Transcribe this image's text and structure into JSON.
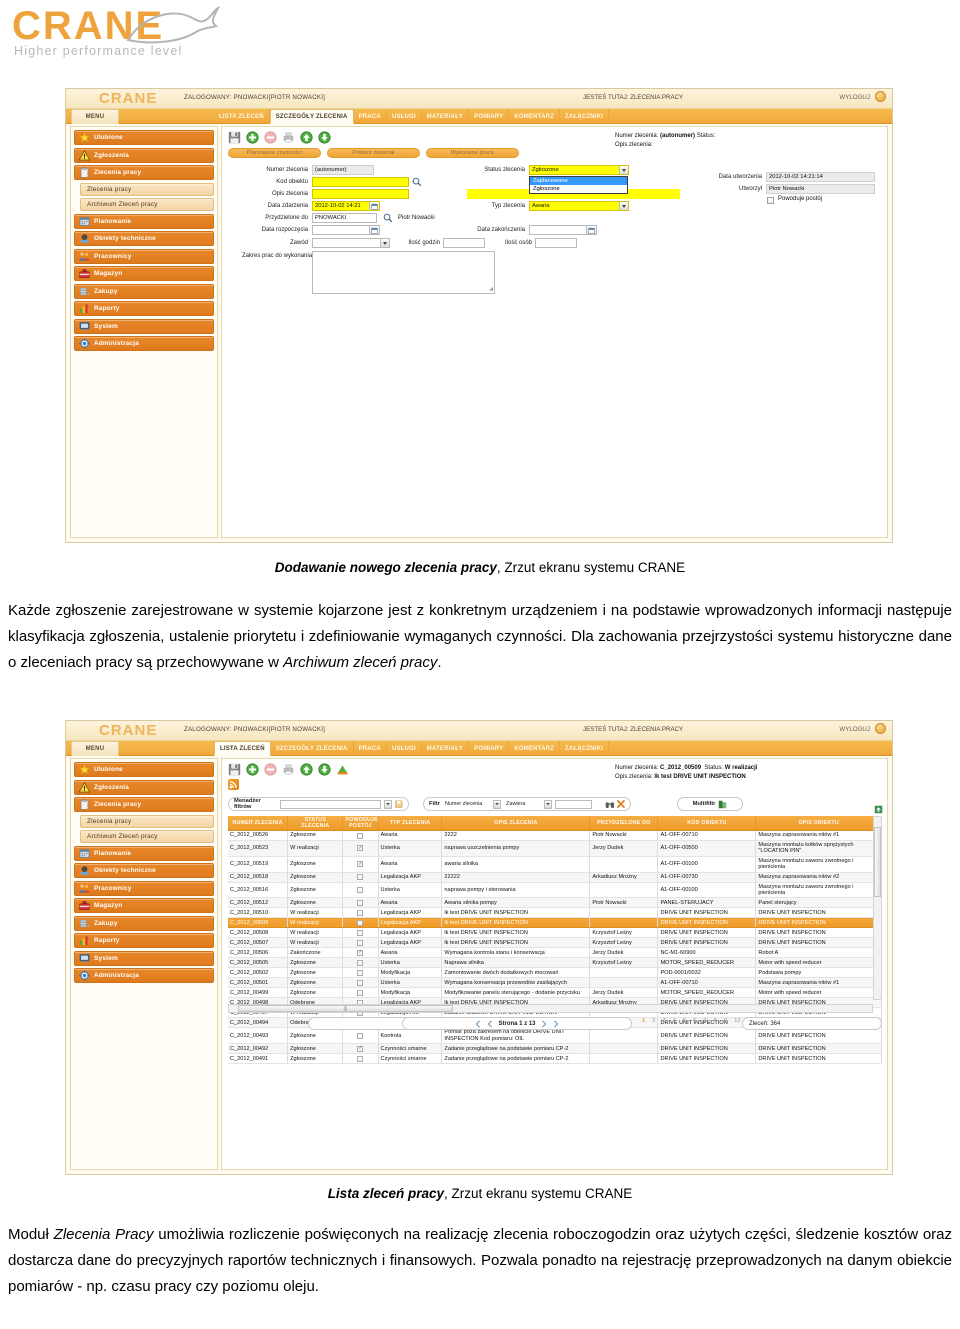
{
  "brand": {
    "name": "CRANE",
    "tagline": "Higher performance level",
    "accent": "#efa33c"
  },
  "screenshot1": {
    "app": {
      "logo": "CRANE",
      "logged_in": "ZALOGOWANY: PNOWACKI[PIOTR NOWACKI]",
      "you_are_here": "JESTEŚ TUTAJ: ZLECENIA PRACY",
      "logout": "WYLOGUJ"
    },
    "menu_tab": "MENU",
    "tabs": [
      {
        "label": "LISTA ZLECEŃ",
        "active": false
      },
      {
        "label": "SZCZEGÓŁY ZLECENIA",
        "active": true
      },
      {
        "label": "PRACA",
        "active": false
      },
      {
        "label": "USŁUGI",
        "active": false
      },
      {
        "label": "MATERIAŁY",
        "active": false
      },
      {
        "label": "POMIARY",
        "active": false
      },
      {
        "label": "KOMENTARZ",
        "active": false
      },
      {
        "label": "ZAŁĄCZNIKI",
        "active": false
      }
    ],
    "sidebar": [
      {
        "label": "Ulubione",
        "icon": "star-icon",
        "sub": false
      },
      {
        "label": "Zgłoszenia",
        "icon": "warning-icon",
        "sub": false
      },
      {
        "label": "Zlecenia pracy",
        "icon": "clipboard-icon",
        "sub": false
      },
      {
        "label": "Zlecenia pracy",
        "icon": "",
        "sub": true
      },
      {
        "label": "Archiwum Zleceń pracy",
        "icon": "",
        "sub": true
      },
      {
        "label": "Planowanie",
        "icon": "calendar-icon",
        "sub": false
      },
      {
        "label": "Obiekty techniczne",
        "icon": "object-icon",
        "sub": false
      },
      {
        "label": "Pracownicy",
        "icon": "people-icon",
        "sub": false
      },
      {
        "label": "Magazyn",
        "icon": "toolbox-icon",
        "sub": false
      },
      {
        "label": "Zakupy",
        "icon": "cart-icon",
        "sub": false
      },
      {
        "label": "Raporty",
        "icon": "chart-icon",
        "sub": false
      },
      {
        "label": "System",
        "icon": "monitor-icon",
        "sub": false
      },
      {
        "label": "Administracja",
        "icon": "gear-icon",
        "sub": false
      }
    ],
    "toolbar_icons": [
      "save-icon",
      "add-icon",
      "delete-icon",
      "print-icon",
      "up-icon",
      "down-icon"
    ],
    "action_buttons": [
      "Planowane czynności",
      "Pobierz materiał",
      "Wykonane prace"
    ],
    "form": {
      "numer_zlecenia_label": "Numer zlecenia",
      "numer_zlecenia_value": "(autonumer)",
      "kod_obiektu_label": "Kod obiektu",
      "kod_obiektu_value": "",
      "opis_zlecenia_label": "Opis zlecenia",
      "opis_zlecenia_value": "",
      "data_zdarzenia_label": "Data zdarzenia",
      "data_zdarzenia_value": "2012-10-02 14:21",
      "przydzielone_do_label": "Przydzielone do",
      "przydzielone_do_value": "PNOWACKI",
      "przydzielone_do_name": "Piotr Nowacki",
      "data_rozpoczecia_label": "Data rozpoczęcia",
      "data_rozpoczecia_value": "",
      "zawod_label": "Zawód",
      "zawod_value": "",
      "zakres_prac_label": "Zakres prac do wykonania",
      "zakres_prac_value": "",
      "status_zlecenia_label": "Status zlecenia",
      "status_zlecenia_value": "Zgłoszone",
      "status_options": [
        "Zaplanowane",
        "Zgłoszone"
      ],
      "status_selected_option": "Zaplanowane",
      "typ_zlecenia_label": "Typ zlecenia",
      "typ_zlecenia_value": "Awaria",
      "data_zakonczenia_label": "Data zakończenia",
      "data_zakonczenia_value": "",
      "ilosc_godzin_label": "Ilość godzin",
      "ilosc_godzin_value": "",
      "ilosc_osob_label": "Ilość osób",
      "ilosc_osob_value": ""
    },
    "header_info": {
      "numer_label": "Numer zlecenia:",
      "numer_value": "(autonumer)",
      "status_label": "Status:",
      "status_value": "",
      "opis_label": "Opis zlecenia:",
      "opis_value": ""
    },
    "meta": {
      "data_utworzenia_label": "Data utworzenia",
      "data_utworzenia_value": "2012-10-02 14:21:14",
      "utworzyl_label": "Utworzył",
      "utworzyl_value": "Piotr Nowacki",
      "powoduje_postoj_label": "Powoduje postój",
      "powoduje_postoj_checked": false
    }
  },
  "caption1": {
    "bold": "Dodawanie nowego zlecenia pracy",
    "rest": ", Zrzut ekranu systemu CRANE"
  },
  "paragraph1": "Każde zgłoszenie zarejestrowane w systemie kojarzone jest z konkretnym urządzeniem i na podstawie wprowadzonych informacji następuje klasyfikacja zgłoszenia, ustalenie priorytetu i zdefiniowanie wymaganych czynności. Dla zachowania przejrzystości systemu historyczne dane o zleceniach pracy są przechowywane w ",
  "paragraph1_italic_tail": "Archiwum zleceń pracy",
  "paragraph1_end": ".",
  "screenshot2": {
    "app": {
      "logo": "CRANE",
      "logged_in": "ZALOGOWANY: PNOWACKI[PIOTR NOWACKI]",
      "you_are_here": "JESTEŚ TUTAJ: ZLECENIA PRACY",
      "logout": "WYLOGUJ"
    },
    "menu_tab": "MENU",
    "tabs": [
      {
        "label": "LISTA ZLECEŃ",
        "active": true
      },
      {
        "label": "SZCZEGÓŁY ZLECENIA",
        "active": false
      },
      {
        "label": "PRACA",
        "active": false
      },
      {
        "label": "USŁUGI",
        "active": false
      },
      {
        "label": "MATERIAŁY",
        "active": false
      },
      {
        "label": "POMIARY",
        "active": false
      },
      {
        "label": "KOMENTARZ",
        "active": false
      },
      {
        "label": "ZAŁĄCZNIKI",
        "active": false
      }
    ],
    "sidebar": [
      {
        "label": "Ulubione",
        "icon": "star-icon",
        "sub": false
      },
      {
        "label": "Zgłoszenia",
        "icon": "warning-icon",
        "sub": false
      },
      {
        "label": "Zlecenia pracy",
        "icon": "clipboard-icon",
        "sub": false
      },
      {
        "label": "Zlecenia pracy",
        "icon": "",
        "sub": true
      },
      {
        "label": "Archiwum Zleceń pracy",
        "icon": "",
        "sub": true
      },
      {
        "label": "Planowanie",
        "icon": "calendar-icon",
        "sub": false
      },
      {
        "label": "Obiekty techniczne",
        "icon": "object-icon",
        "sub": false
      },
      {
        "label": "Pracownicy",
        "icon": "people-icon",
        "sub": false
      },
      {
        "label": "Magazyn",
        "icon": "toolbox-icon",
        "sub": false
      },
      {
        "label": "Zakupy",
        "icon": "cart-icon",
        "sub": false
      },
      {
        "label": "Raporty",
        "icon": "chart-icon",
        "sub": false
      },
      {
        "label": "System",
        "icon": "monitor-icon",
        "sub": false
      },
      {
        "label": "Administracja",
        "icon": "gear-icon",
        "sub": false
      }
    ],
    "toolbar_icons": [
      "save-icon",
      "add-icon",
      "delete-icon",
      "print-icon",
      "up-icon",
      "down-icon",
      "export-icon",
      "rss-icon"
    ],
    "header_info": {
      "numer_label": "Numer zlecenia:",
      "numer_value": "C_2012_00509",
      "status_label": "Status:",
      "status_value": "W realizacji",
      "opis_label": "Opis zlecenia:",
      "opis_value": "lk test DRIVE UNIT INSPECTION"
    },
    "filterbar": {
      "menadzer_label": "Menadżer filtrów",
      "menadzer_value": "",
      "filtr_label": "Filtr",
      "filtr_field": "Numer zlecenia",
      "filtr_operator": "Zawiera",
      "filtr_value": "",
      "search_icon": "binoculars-icon",
      "clear_icon": "clear-x-icon",
      "multifiltr_label": "Multifiltr"
    },
    "table": {
      "columns": [
        "NUMER ZLECENIA",
        "STATUS ZLECENIA",
        "POWODUJE POSTÓJ",
        "TYP ZLECENIA",
        "OPIS ZLECENIA",
        "PRZYDZIELONE DO",
        "KOD OBIEKTU",
        "OPIS OBIEKTU"
      ],
      "rows": [
        {
          "numer": "C_2012_00526",
          "status": "Zgłoszone",
          "postoj": false,
          "typ": "Awaria",
          "opis": "2222",
          "przydzielone": "Piotr Nowacki",
          "kod": "A1-OFF-00710",
          "opis_obiektu": "Maszyna zaprasowania nitów #1",
          "selected": false
        },
        {
          "numer": "C_2012_00523",
          "status": "W realizacji",
          "postoj": true,
          "typ": "Usterka",
          "opis": "naprawa uszczelnienia pompy",
          "przydzielone": "Jerzy Dudek",
          "kod": "A1-OFF-00500",
          "opis_obiektu": "Maszyna montażu kołków sprężystych \"LOCATION PIN\"",
          "selected": false
        },
        {
          "numer": "C_2012_00519",
          "status": "Zgłoszone",
          "postoj": true,
          "typ": "Awaria",
          "opis": "awaria silnika",
          "przydzielone": "",
          "kod": "A1-OFF-00100",
          "opis_obiektu": "Maszyna montażu zaworu zwrotnego i pierścienia",
          "selected": false
        },
        {
          "numer": "C_2012_00518",
          "status": "Zgłoszone",
          "postoj": false,
          "typ": "Legalizacja AKP",
          "opis": "22222",
          "przydzielone": "Arkadiusz Mroźny",
          "kod": "A1-OFF-00730",
          "opis_obiektu": "Maszyna zaprasowania nitów #2",
          "selected": false
        },
        {
          "numer": "C_2012_00516",
          "status": "Zgłoszone",
          "postoj": false,
          "typ": "Usterka",
          "opis": "naprawa pompy i sterowania",
          "przydzielone": "",
          "kod": "A1-OFF-00100",
          "opis_obiektu": "Maszyna montażu zaworu zwrotnego i pierścienia",
          "selected": false
        },
        {
          "numer": "C_2012_00512",
          "status": "Zgłoszone",
          "postoj": false,
          "typ": "Awaria",
          "opis": "Awaria silnika pompy",
          "przydzielone": "Piotr Nowacki",
          "kod": "PANEL-STERUJACY",
          "opis_obiektu": "Panel sterujący",
          "selected": false
        },
        {
          "numer": "C_2012_00510",
          "status": "W realizacji",
          "postoj": false,
          "typ": "Legalizacja AKP",
          "opis": "lk test DRIVE UNIT INSPECTION",
          "przydzielone": "",
          "kod": "DRIVE UNIT INSPECTION",
          "opis_obiektu": "DRIVE UNIT INSPECTION",
          "selected": false
        },
        {
          "numer": "C_2012_00509",
          "status": "W realizacji",
          "postoj": false,
          "typ": "Legalizacja AKP",
          "opis": "lk test DRIVE UNIT INSPECTION",
          "przydzielone": "",
          "kod": "DRIVE UNIT INSPECTION",
          "opis_obiektu": "DRIVE UNIT INSPECTION",
          "selected": true
        },
        {
          "numer": "C_2012_00508",
          "status": "W realizacji",
          "postoj": false,
          "typ": "Legalizacja AKP",
          "opis": "lk test DRIVE UNIT INSPECTION",
          "przydzielone": "Krzysztof Leśny",
          "kod": "DRIVE UNIT INSPECTION",
          "opis_obiektu": "DRIVE UNIT INSPECTION",
          "selected": false
        },
        {
          "numer": "C_2012_00507",
          "status": "W realizacji",
          "postoj": false,
          "typ": "Legalizacja AKP",
          "opis": "lk test DRIVE UNIT INSPECTION",
          "przydzielone": "Krzysztof Leśny",
          "kod": "DRIVE UNIT INSPECTION",
          "opis_obiektu": "DRIVE UNIT INSPECTION",
          "selected": false
        },
        {
          "numer": "C_2012_00506",
          "status": "Zakończone",
          "postoj": true,
          "typ": "Awaria",
          "opis": "Wymagana kontrola stanu i konserwacja",
          "przydzielone": "Jerzy Dudek",
          "kod": "NC-M1-60900",
          "opis_obiektu": "Robot A",
          "selected": false
        },
        {
          "numer": "C_2012_00505",
          "status": "Zgłoszone",
          "postoj": false,
          "typ": "Usterka",
          "opis": "Naprawa silnika",
          "przydzielone": "Krzysztof Leśny",
          "kod": "MOTOR_SPEED_REDUCER",
          "opis_obiektu": "Motor with speed reducer",
          "selected": false
        },
        {
          "numer": "C_2012_00502",
          "status": "Zgłoszone",
          "postoj": false,
          "typ": "Modyfikacja",
          "opis": "Zamontowanie dwóch dodatkowych mocowań",
          "przydzielone": "",
          "kod": "POD-0001/0032",
          "opis_obiektu": "Podstawa pompy",
          "selected": false
        },
        {
          "numer": "C_2012_00501",
          "status": "Zgłoszone",
          "postoj": false,
          "typ": "Usterka",
          "opis": "Wymagana konserwacja przewodów zasilających",
          "przydzielone": "",
          "kod": "A1-OFF-00710",
          "opis_obiektu": "Maszyna zaprasowania nitów #1",
          "selected": false
        },
        {
          "numer": "C_2012_00499",
          "status": "Zgłoszone",
          "postoj": false,
          "typ": "Modyfikacja",
          "opis": "Modyfikowanie panelu sterującego - dodanie przycisku",
          "przydzielone": "Jerzy Dudek",
          "kod": "MOTOR_SPEED_REDUCER",
          "opis_obiektu": "Motor with speed reducer",
          "selected": false
        },
        {
          "numer": "C_2012_00498",
          "status": "Odebrane",
          "postoj": false,
          "typ": "Legalizacja AKP",
          "opis": "lk test DRIVE UNIT INSPECTION",
          "przydzielone": "Arkadiusz Mroźny",
          "kod": "DRIVE UNIT INSPECTION",
          "opis_obiektu": "DRIVE UNIT INSPECTION",
          "selected": false
        },
        {
          "numer": "C_2012_00497",
          "status": "W realizacji",
          "postoj": false,
          "typ": "Legalizacja AKP",
          "opis": "Zadanie czasowe DRIVE UNIT INSPECTION",
          "przydzielone": "",
          "kod": "DRIVE UNIT INSPECTION",
          "opis_obiektu": "DRIVE UNIT INSPECTION",
          "selected": false
        },
        {
          "numer": "C_2012_00494",
          "status": "Odebrane",
          "postoj": false,
          "typ": "Legalizacja AKP",
          "opis": "Zadanie czasowe DRIVE UNIT INSPECTION",
          "przydzielone": "Bogumił Rogal",
          "kod": "DRIVE UNIT INSPECTION",
          "opis_obiektu": "DRIVE UNIT INSPECTION",
          "selected": false
        },
        {
          "numer": "C_2012_00493",
          "status": "Zgłoszone",
          "postoj": false,
          "typ": "Kontrola",
          "opis": "Pomiar poza zakresem na obiekcie DRIVE UNIT INSPECTION Kod pomiaru: OIL",
          "przydzielone": "",
          "kod": "DRIVE UNIT INSPECTION",
          "opis_obiektu": "DRIVE UNIT INSPECTION",
          "selected": false
        },
        {
          "numer": "C_2012_00492",
          "status": "Zgłoszone",
          "postoj": true,
          "typ": "Czynności smarne",
          "opis": "Zadanie przeglądowe na podstawie pomiaru CP-2",
          "przydzielone": "",
          "kod": "DRIVE UNIT INSPECTION",
          "opis_obiektu": "DRIVE UNIT INSPECTION",
          "selected": false
        },
        {
          "numer": "C_2012_00491",
          "status": "Zgłoszone",
          "postoj": false,
          "typ": "Czynności smarne",
          "opis": "Zadanie przeglądowe na podstawie pomiaru CP-2",
          "przydzielone": "",
          "kod": "DRIVE UNIT INSPECTION",
          "opis_obiektu": "DRIVE UNIT INSPECTION",
          "selected": false
        }
      ]
    },
    "pager": {
      "page_text": "Strona 1 z 13",
      "numbers": [
        "1",
        "2",
        "3",
        "4",
        "5",
        "6",
        "7",
        "8",
        "9",
        "10",
        "...>>"
      ],
      "current": "1",
      "count_label": "Zleceń: 364"
    }
  },
  "caption2": {
    "bold": "Lista zleceń pracy",
    "rest": ", Zrzut ekranu systemu CRANE"
  },
  "paragraph2_a": "Moduł ",
  "paragraph2_italic": "Zlecenia Pracy",
  "paragraph2_b": " umożliwia rozliczenie poświęconych na realizację zlecenia roboczogodzin oraz użytych części, śledzenie kosztów oraz dostarcza dane do precyzyjnych raportów technicznych i finansowych. Pozwala ponadto na rejestrację przeprowadzonych na danym obiekcie pomiarów - np. czasu pracy czy poziomu oleju."
}
